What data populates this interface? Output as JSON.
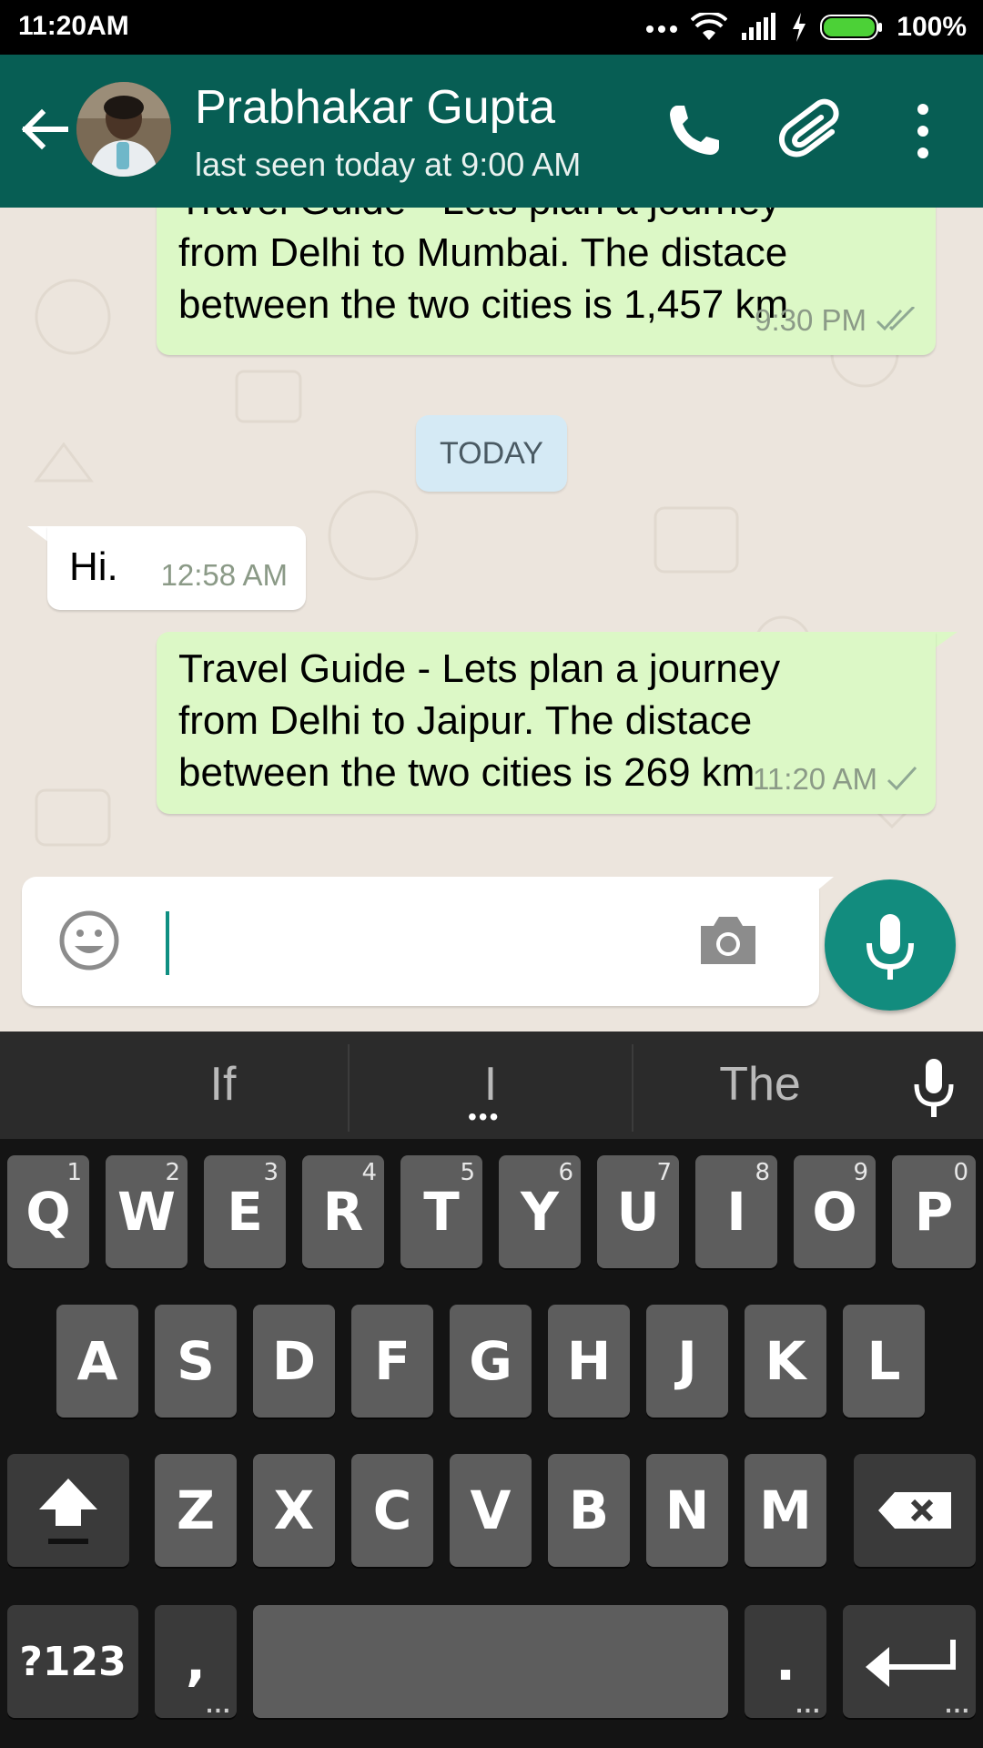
{
  "status_bar": {
    "time": "11:20AM",
    "battery_percent": "100%",
    "icons": [
      "more-dots-icon",
      "wifi-icon",
      "signal-icon",
      "charging-icon",
      "battery-icon"
    ]
  },
  "header": {
    "contact_name": "Prabhakar Gupta",
    "last_seen": "last seen today at 9:00 AM",
    "icons": [
      "back-arrow-icon",
      "phone-icon",
      "attachment-icon",
      "overflow-menu-icon"
    ]
  },
  "chat": {
    "messages": [
      {
        "direction": "outgoing",
        "text": "Travel Guide - Lets plan a journey\nfrom Delhi to Mumbai. The distace\nbetween the two cities is 1,457 km",
        "time": "9:30 PM",
        "ticks": "read"
      },
      {
        "direction": "incoming",
        "text": "Hi.",
        "time": "12:58 AM"
      },
      {
        "direction": "outgoing",
        "text": "Travel Guide - Lets plan a journey\nfrom Delhi to Jaipur. The distace\nbetween the two cities is 269 km",
        "time": "11:20 AM",
        "ticks": "sent"
      }
    ],
    "date_divider": "TODAY"
  },
  "composer": {
    "value": "",
    "icons": [
      "emoji-icon",
      "camera-icon",
      "microphone-icon"
    ]
  },
  "keyboard": {
    "suggestions": [
      "If",
      "I",
      "The"
    ],
    "row1": [
      {
        "key": "Q",
        "hint": "1"
      },
      {
        "key": "W",
        "hint": "2"
      },
      {
        "key": "E",
        "hint": "3"
      },
      {
        "key": "R",
        "hint": "4"
      },
      {
        "key": "T",
        "hint": "5"
      },
      {
        "key": "Y",
        "hint": "6"
      },
      {
        "key": "U",
        "hint": "7"
      },
      {
        "key": "I",
        "hint": "8"
      },
      {
        "key": "O",
        "hint": "9"
      },
      {
        "key": "P",
        "hint": "0"
      }
    ],
    "row2": [
      "A",
      "S",
      "D",
      "F",
      "G",
      "H",
      "J",
      "K",
      "L"
    ],
    "row3": [
      "Z",
      "X",
      "C",
      "V",
      "B",
      "N",
      "M"
    ],
    "symbols_key": "?123",
    "comma_key": ",",
    "period_key": ".",
    "colors": {
      "key": "#5d5d5d",
      "dark_key": "#3a3a3a",
      "background": "#141414"
    }
  },
  "colors": {
    "header": "#075e54",
    "outgoing_bubble": "#dcf8c6",
    "incoming_bubble": "#ffffff",
    "accent": "#128c7e",
    "read_tick": "#8fa893"
  }
}
